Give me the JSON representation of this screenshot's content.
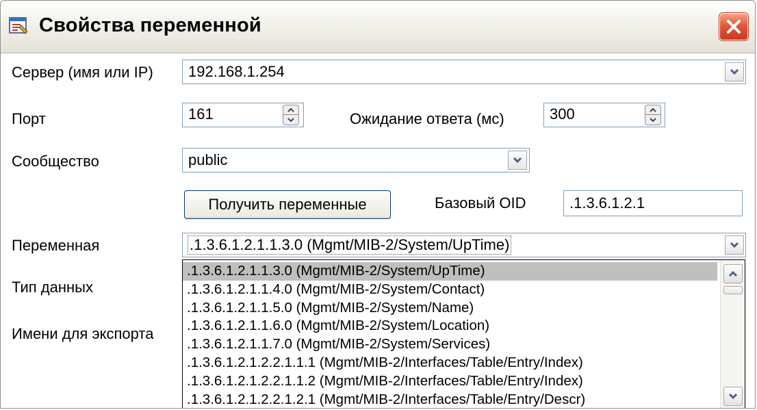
{
  "window": {
    "title": "Свойства переменной",
    "icon": "properties-window-icon",
    "close_icon": "close-icon"
  },
  "form": {
    "server_label": "Сервер (имя или IP)",
    "server_value": "192.168.1.254",
    "port_label": "Порт",
    "port_value": "161",
    "timeout_label": "Ожидание ответа (мс)",
    "timeout_value": "300",
    "community_label": "Сообщество",
    "community_value": "public",
    "get_vars_button": "Получить переменные",
    "base_oid_label": "Базовый OID",
    "base_oid_value": ".1.3.6.1.2.1",
    "variable_label": "Переменная",
    "variable_value": ".1.3.6.1.2.1.1.3.0 (Mgmt/MIB-2/System/UpTime)",
    "data_type_label": "Тип данных",
    "export_name_label": "Имени для экспорта"
  },
  "dropdown": {
    "items": [
      ".1.3.6.1.2.1.1.3.0 (Mgmt/MIB-2/System/UpTime)",
      ".1.3.6.1.2.1.1.4.0 (Mgmt/MIB-2/System/Contact)",
      ".1.3.6.1.2.1.1.5.0 (Mgmt/MIB-2/System/Name)",
      ".1.3.6.1.2.1.1.6.0 (Mgmt/MIB-2/System/Location)",
      ".1.3.6.1.2.1.1.7.0 (Mgmt/MIB-2/System/Services)",
      ".1.3.6.1.2.1.2.2.1.1.1 (Mgmt/MIB-2/Interfaces/Table/Entry/Index)",
      ".1.3.6.1.2.1.2.2.1.1.2 (Mgmt/MIB-2/Interfaces/Table/Entry/Index)",
      ".1.3.6.1.2.1.2.2.1.2.1 (Mgmt/MIB-2/Interfaces/Table/Entry/Descr)"
    ],
    "selected_index": 0
  },
  "colors": {
    "close_button": "#e2593a",
    "selection": "#bfbfbf",
    "field_border": "#7f9db9",
    "button_border": "#003c74"
  }
}
